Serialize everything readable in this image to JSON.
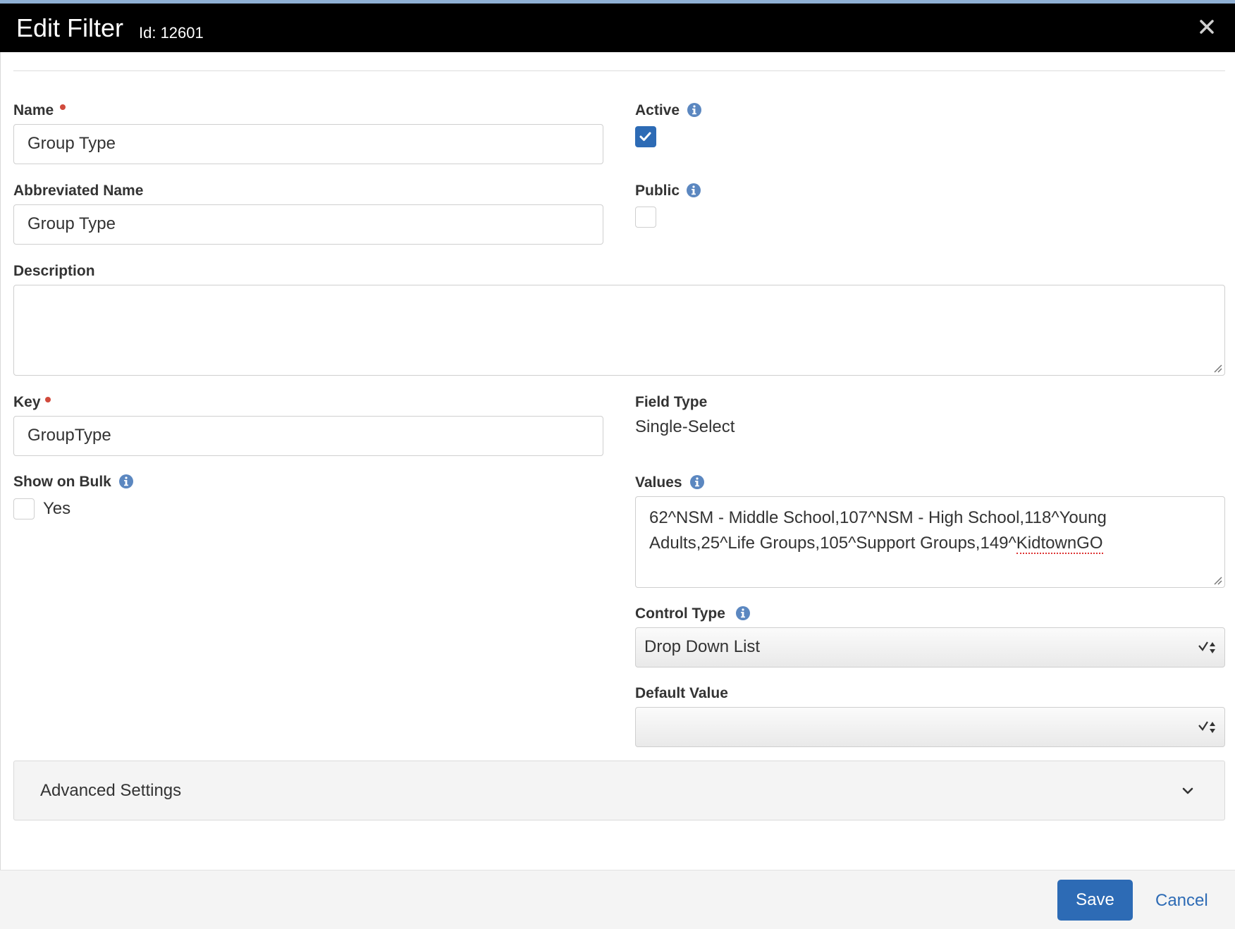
{
  "dialog": {
    "title": "Edit Filter",
    "id_text": "Id: 12601"
  },
  "form": {
    "name": {
      "label": "Name",
      "value": "Group Type"
    },
    "abbreviated_name": {
      "label": "Abbreviated Name",
      "value": "Group Type"
    },
    "active": {
      "label": "Active",
      "checked": true
    },
    "public": {
      "label": "Public",
      "checked": false
    },
    "description": {
      "label": "Description",
      "value": ""
    },
    "key": {
      "label": "Key",
      "value": "GroupType"
    },
    "field_type": {
      "label": "Field Type",
      "value": "Single-Select"
    },
    "show_on_bulk": {
      "label": "Show on Bulk",
      "option_label": "Yes",
      "checked": false
    },
    "values": {
      "label": "Values",
      "value_part1": "62^NSM - Middle School,107^NSM - High School,118^Young",
      "value_part2": "Adults,25^Life Groups,105^Support Groups,149^",
      "value_part3": "KidtownGO"
    },
    "control_type": {
      "label": "Control Type",
      "selected": "Drop Down List"
    },
    "default_value": {
      "label": "Default Value",
      "selected": ""
    }
  },
  "advanced": {
    "label": "Advanced Settings"
  },
  "footer": {
    "save_label": "Save",
    "cancel_label": "Cancel"
  },
  "colors": {
    "primary": "#2d6bb5",
    "required": "#d14a3c",
    "header_bg": "#000000"
  }
}
